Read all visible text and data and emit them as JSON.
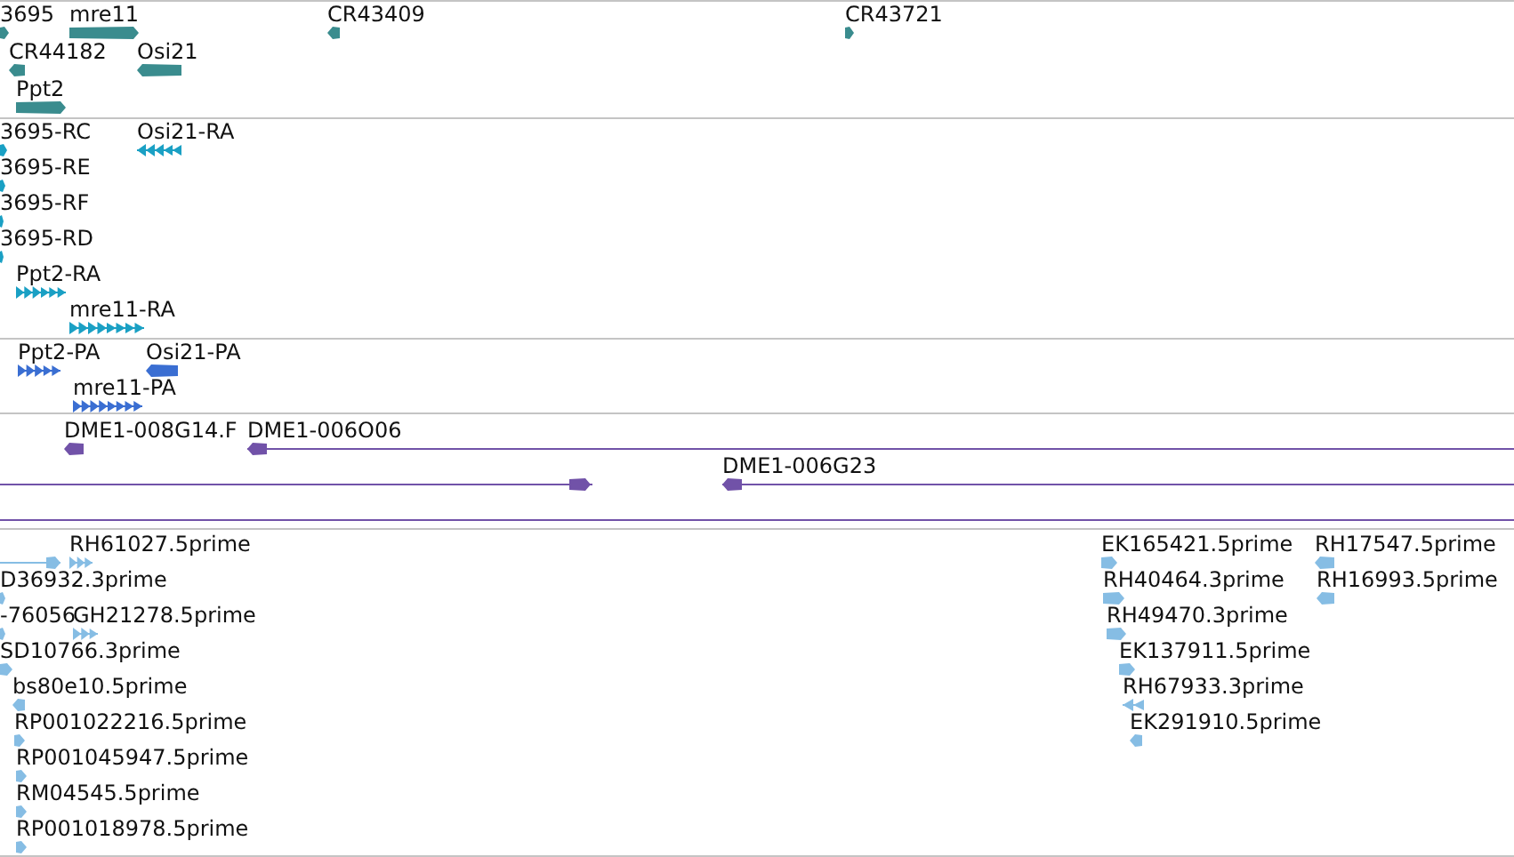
{
  "tracks": [
    {
      "color": "#3a8c8e",
      "features": [
        {
          "label": "3695",
          "kind": "block",
          "reverse": false
        },
        {
          "label": "mre11",
          "kind": "block",
          "reverse": false
        },
        {
          "label": "CR43409",
          "kind": "block",
          "reverse": true
        },
        {
          "label": "CR43721",
          "kind": "block",
          "reverse": false
        },
        {
          "label": "CR44182",
          "kind": "block",
          "reverse": true
        },
        {
          "label": "Osi21",
          "kind": "block",
          "reverse": true
        },
        {
          "label": "Ppt2",
          "kind": "block",
          "reverse": false
        }
      ]
    },
    {
      "color": "#1aa0c4",
      "features": [
        {
          "label": "3695-RC",
          "kind": "block",
          "reverse": false
        },
        {
          "label": "Osi21-RA",
          "kind": "exons",
          "reverse": true
        },
        {
          "label": "3695-RE",
          "kind": "block",
          "reverse": false
        },
        {
          "label": "3695-RF",
          "kind": "block",
          "reverse": false
        },
        {
          "label": "3695-RD",
          "kind": "block",
          "reverse": false
        },
        {
          "label": "Ppt2-RA",
          "kind": "exons",
          "reverse": false
        },
        {
          "label": "mre11-RA",
          "kind": "exons",
          "reverse": false
        }
      ]
    },
    {
      "color": "#3a6ed2",
      "features": [
        {
          "label": "Ppt2-PA",
          "kind": "exons",
          "reverse": false
        },
        {
          "label": "Osi21-PA",
          "kind": "block",
          "reverse": true
        },
        {
          "label": "mre11-PA",
          "kind": "exons",
          "reverse": false
        }
      ]
    },
    {
      "color": "#7152a8",
      "features": [
        {
          "label": "DME1-008G14.F",
          "kind": "block",
          "reverse": true
        },
        {
          "label": "DME1-006O06",
          "kind": "spliced",
          "reverse": true
        },
        {
          "kind": "spliced",
          "reverse": false
        },
        {
          "label": "DME1-006G23",
          "kind": "spliced",
          "reverse": true
        },
        {
          "kind": "line"
        }
      ]
    },
    {
      "color": "#86bde4",
      "features": [
        {
          "kind": "spliced",
          "reverse": false
        },
        {
          "label": "RH61027.5prime",
          "kind": "exons",
          "reverse": false
        },
        {
          "label": "EK165421.5prime",
          "kind": "block",
          "reverse": false
        },
        {
          "label": "RH17547.5prime",
          "kind": "block",
          "reverse": true
        },
        {
          "label": "D36932.3prime",
          "kind": "block",
          "reverse": false
        },
        {
          "label": "RH40464.3prime",
          "kind": "block",
          "reverse": false
        },
        {
          "label": "RH16993.5prime",
          "kind": "block",
          "reverse": true
        },
        {
          "label": "-76056",
          "kind": "block",
          "reverse": false
        },
        {
          "label": "GH21278.5prime",
          "kind": "exons",
          "reverse": false
        },
        {
          "label": "RH49470.3prime",
          "kind": "block",
          "reverse": false
        },
        {
          "label": "SD10766.3prime",
          "kind": "block",
          "reverse": false
        },
        {
          "label": "EK137911.5prime",
          "kind": "block",
          "reverse": false
        },
        {
          "label": "bs80e10.5prime",
          "kind": "block",
          "reverse": true
        },
        {
          "label": "RH67933.3prime",
          "kind": "exons",
          "reverse": true
        },
        {
          "label": "RP001022216.5prime",
          "kind": "block",
          "reverse": false
        },
        {
          "label": "EK291910.5prime",
          "kind": "block",
          "reverse": true
        },
        {
          "label": "RP001045947.5prime",
          "kind": "block",
          "reverse": false
        },
        {
          "label": "RM04545.5prime",
          "kind": "block",
          "reverse": false
        },
        {
          "label": "RP001018978.5prime",
          "kind": "block",
          "reverse": false
        }
      ]
    }
  ]
}
